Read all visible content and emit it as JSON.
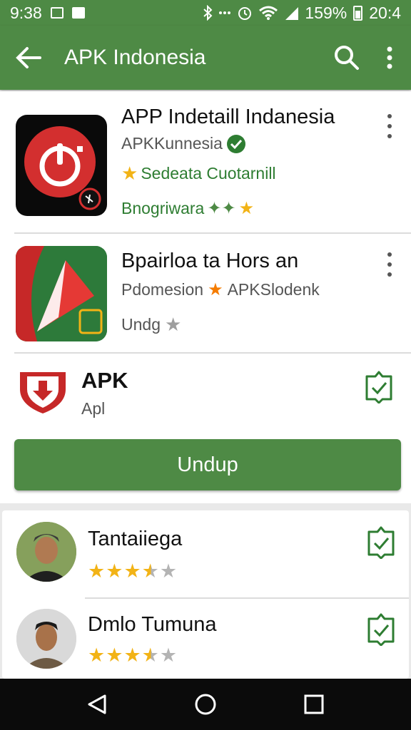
{
  "status_bar": {
    "time": "9:38",
    "battery_percent": "159%",
    "clock_right": "20:4"
  },
  "app_bar": {
    "title": "APK Indonesia",
    "icons": [
      "arrow-back-icon",
      "search-icon",
      "more-vert-icon"
    ]
  },
  "apps": [
    {
      "title": "APP Indetaill Indanesia",
      "developer": "APKKunnesia",
      "line3": "Sedeata Cuotarnill",
      "line4": "Bnogriwara"
    },
    {
      "title": "Bpairloa ta Hors an",
      "developer_prefix": "Pdomesion",
      "developer_suffix": "APKSlodenk",
      "line3": "Undg"
    },
    {
      "title": "APK",
      "subtitle": "Apl"
    }
  ],
  "install_button": {
    "label": "Undup"
  },
  "reviews": [
    {
      "name": "Tantaiiega",
      "rating": 3.5
    },
    {
      "name": "Dmlo Tumuna",
      "rating": 3.5
    }
  ],
  "colors": {
    "brand_green": "#4e8a45",
    "text_green": "#2e7d32",
    "star_gold": "#f2b316",
    "icon_red": "#d32f2f"
  }
}
